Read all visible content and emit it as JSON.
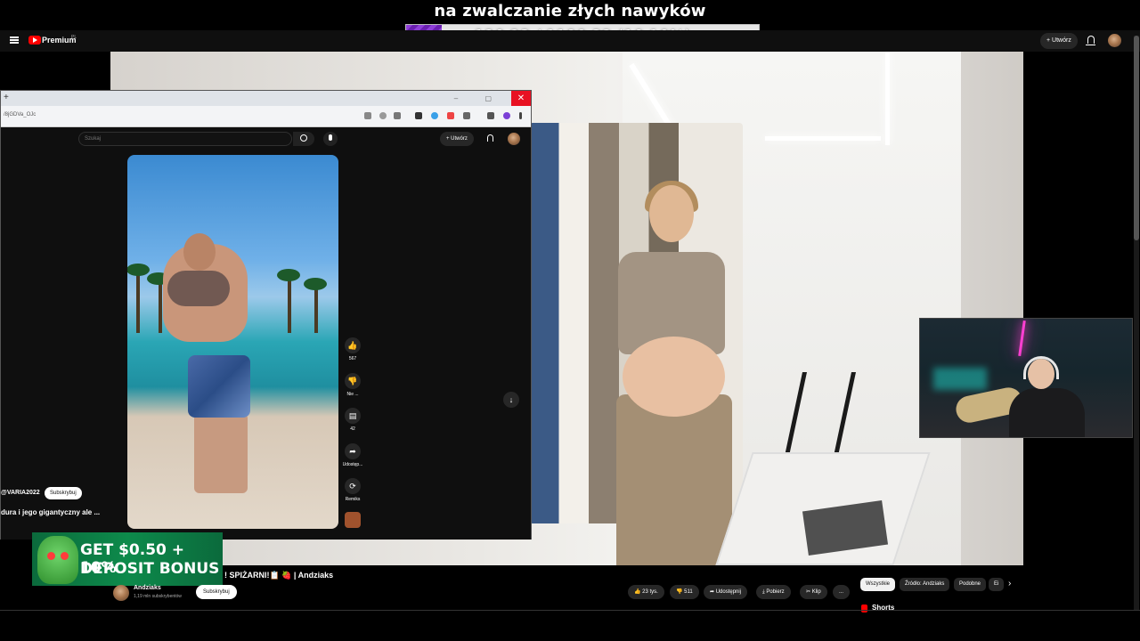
{
  "overlay": {
    "title": "na zwalczanie złych nawyków",
    "progress_text": "120.23 / 1190.32 (10.10%)",
    "progress_fraction": 0.101
  },
  "yt_header": {
    "brand": "Premium",
    "country": "PL",
    "create_label": "Utwórz"
  },
  "browser": {
    "url": "/8jGDVa_OJc",
    "search_placeholder": "Szukaj",
    "create_label": "Utwórz",
    "short": {
      "like_count": "567",
      "dislike_label": "Nie ...",
      "comment_count": "42",
      "share_label": "Udostęp...",
      "remix_label": "Remiks",
      "channel_handle": "@VARIA2022",
      "subscribe_label": "Subskrybuj",
      "caption": "dura i jego gigantyczny ale ..."
    }
  },
  "ad": {
    "line1": "GET $0.50 + 10%",
    "line2": "DEPOSIT BONUS"
  },
  "video": {
    "title": "! SPIŻARNI!📋 🍓 | Andziaks",
    "channel_name": "Andziaks",
    "channel_subs": "1,19 mln subskrybentów",
    "subscribe_label": "Subskrybuj",
    "likes": "23 tys.",
    "dislikes": "511",
    "share_label": "Udostępnij",
    "download_label": "Pobierz",
    "clip_label": "Klip",
    "more_label": "..."
  },
  "sidebar_chips": [
    "Wszystkie",
    "Źródło: Andziaks",
    "Podobne",
    "Ei"
  ],
  "shorts_label": "Shorts",
  "colors": {
    "yt_red": "#ff0000",
    "progress_purple": "#8f3fd8",
    "close_red": "#e81123"
  }
}
